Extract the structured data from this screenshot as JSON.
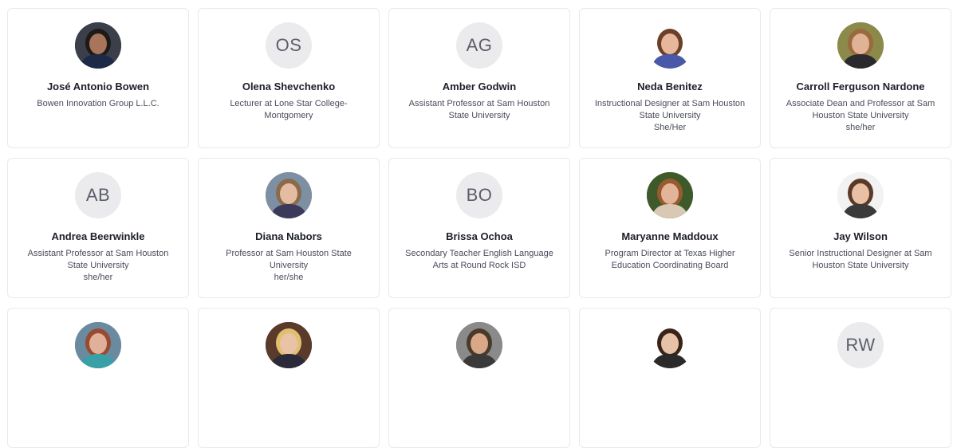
{
  "people": [
    {
      "name": "José Antonio Bowen",
      "title": "Bowen Innovation Group L.L.C.",
      "pronouns": "",
      "initials": "",
      "photo": true,
      "palette": {
        "bg": "#3a3f4a",
        "skin": "#a8745a",
        "hair": "#1e1a18",
        "shirt": "#1c2a48"
      }
    },
    {
      "name": "Olena Shevchenko",
      "title": "Lecturer at Lone Star College-Montgomery",
      "pronouns": "",
      "initials": "OS",
      "photo": false
    },
    {
      "name": "Amber Godwin",
      "title": "Assistant Professor at Sam Houston State University",
      "pronouns": "",
      "initials": "AG",
      "photo": false
    },
    {
      "name": "Neda Benitez",
      "title": "Instructional Designer at Sam Houston State University",
      "pronouns": "She/Her",
      "initials": "",
      "photo": true,
      "palette": {
        "bg": "#ffffff",
        "skin": "#e6b79a",
        "hair": "#6b4028",
        "shirt": "#4a58a8"
      }
    },
    {
      "name": "Carroll Ferguson Nardone",
      "title": "Associate Dean and Professor at Sam Houston State University",
      "pronouns": "she/her",
      "initials": "",
      "photo": true,
      "palette": {
        "bg": "#8b8a4a",
        "skin": "#e0b296",
        "hair": "#9a6a3c",
        "shirt": "#2a2a2e"
      }
    },
    {
      "name": "Andrea Beerwinkle",
      "title": "Assistant Professor at Sam Houston State University",
      "pronouns": "she/her",
      "initials": "AB",
      "photo": false
    },
    {
      "name": "Diana Nabors",
      "title": "Professor at Sam Houston State University",
      "pronouns": "her/she",
      "initials": "",
      "photo": true,
      "palette": {
        "bg": "#7d8fa3",
        "skin": "#e4bca2",
        "hair": "#8a6a4a",
        "shirt": "#3b3a5a"
      }
    },
    {
      "name": "Brissa Ochoa",
      "title": "Secondary Teacher English Language Arts at Round Rock ISD",
      "pronouns": "",
      "initials": "BO",
      "photo": false
    },
    {
      "name": "Maryanne Maddoux",
      "title": "Program Director at Texas Higher Education Coordinating Board",
      "pronouns": "",
      "initials": "",
      "photo": true,
      "palette": {
        "bg": "#3e5a2a",
        "skin": "#e2b498",
        "hair": "#9a5a30",
        "shirt": "#d8c8b4"
      }
    },
    {
      "name": "Jay Wilson",
      "title": "Senior Instructional Designer at Sam Houston State University",
      "pronouns": "",
      "initials": "",
      "photo": true,
      "palette": {
        "bg": "#f2f2f2",
        "skin": "#e8c0a6",
        "hair": "#5a3a26",
        "shirt": "#3a3a3a"
      }
    },
    {
      "name": "",
      "title": "",
      "pronouns": "",
      "initials": "",
      "photo": true,
      "palette": {
        "bg": "#6a8aa0",
        "skin": "#e0b09a",
        "hair": "#9a4a30",
        "shirt": "#3aa0a8"
      }
    },
    {
      "name": "",
      "title": "",
      "pronouns": "",
      "initials": "",
      "photo": true,
      "palette": {
        "bg": "#5a3a2a",
        "skin": "#eac2a6",
        "hair": "#e0c070",
        "shirt": "#2a2a3a"
      }
    },
    {
      "name": "",
      "title": "",
      "pronouns": "",
      "initials": "",
      "photo": true,
      "palette": {
        "bg": "#8a8a8a",
        "skin": "#d8a888",
        "hair": "#4a3a2a",
        "shirt": "#3a3a3a"
      }
    },
    {
      "name": "",
      "title": "",
      "pronouns": "",
      "initials": "",
      "photo": true,
      "palette": {
        "bg": "#ffffff",
        "skin": "#e8c2a8",
        "hair": "#3a2418",
        "shirt": "#2a2a2a"
      }
    },
    {
      "name": "",
      "title": "",
      "pronouns": "",
      "initials": "RW",
      "photo": false
    }
  ]
}
